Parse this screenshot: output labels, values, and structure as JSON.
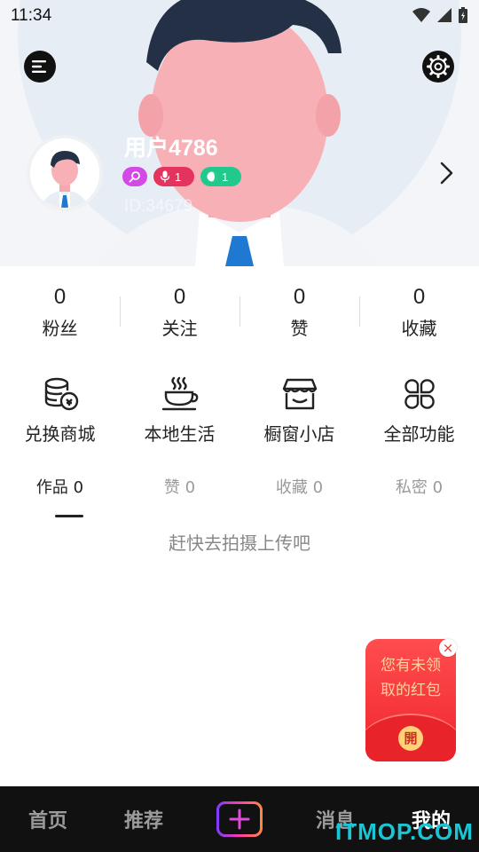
{
  "status_bar": {
    "time": "11:34"
  },
  "profile": {
    "username": "用户4786",
    "user_id": "ID:34679",
    "badges": {
      "mic_level": "1",
      "dot_level": "1"
    }
  },
  "stats": [
    {
      "value": "0",
      "label": "粉丝"
    },
    {
      "value": "0",
      "label": "关注"
    },
    {
      "value": "0",
      "label": "赞"
    },
    {
      "value": "0",
      "label": "收藏"
    }
  ],
  "features": [
    {
      "label": "兑换商城",
      "icon": "coins-icon"
    },
    {
      "label": "本地生活",
      "icon": "coffee-cup-icon"
    },
    {
      "label": "橱窗小店",
      "icon": "storefront-icon"
    },
    {
      "label": "全部功能",
      "icon": "grid-clover-icon"
    }
  ],
  "tabs": [
    {
      "label": "作品 0"
    },
    {
      "label": "赞 0"
    },
    {
      "label": "收藏 0"
    },
    {
      "label": "私密 0"
    }
  ],
  "empty_hint": "赶快去拍摄上传吧",
  "red_packet": {
    "line1": "您有未领",
    "line2": "取的红包",
    "seal": "開"
  },
  "bottom_nav": {
    "home": "首页",
    "recommend": "推荐",
    "messages": "消息",
    "me": "我的"
  },
  "watermark": "ITMOP.COM",
  "colors": {
    "accent_pink": "#d34ae6",
    "badge_red": "#e5335f",
    "badge_green": "#22c98d",
    "nav_bg": "#111111"
  }
}
